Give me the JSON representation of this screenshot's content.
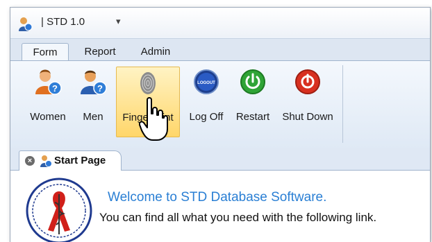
{
  "window": {
    "title": "| STD 1.0",
    "qat_arrow": "▾"
  },
  "tabs": [
    "Form",
    "Report",
    "Admin"
  ],
  "ribbon": {
    "buttons": [
      {
        "label": "Women",
        "icon": "woman-help-icon"
      },
      {
        "label": "Men",
        "icon": "man-help-icon"
      },
      {
        "label": "FingerPrint",
        "icon": "fingerprint-icon"
      },
      {
        "label": "Log Off",
        "icon": "logout-icon"
      },
      {
        "label": "Restart",
        "icon": "power-icon"
      },
      {
        "label": "Shut Down",
        "icon": "shutdown-icon"
      }
    ],
    "logout_icon_text": "LOGOUT"
  },
  "document_tab": {
    "label": "Start Page",
    "close": "×"
  },
  "start_page": {
    "welcome": "Welcome to STD Database Software.",
    "subtext": "You can find all what you need with the following link."
  },
  "colors": {
    "accent": "#2a7fd4",
    "hover": "#ffd66a"
  }
}
